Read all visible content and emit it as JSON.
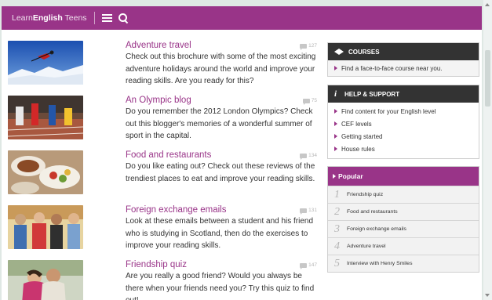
{
  "header": {
    "logo_light": "Learn",
    "logo_bold": "English",
    "logo_end": " Teens"
  },
  "articles": [
    {
      "title": "Adventure travel",
      "count": "127",
      "text": "Check out this brochure with some of the most exciting adventure holidays around the world and improve your reading skills. Are you ready for this?"
    },
    {
      "title": "An Olympic blog",
      "count": "75",
      "text": "Do you remember the 2012 London Olympics? Check out this blogger's memories of a wonderful summer of sport in the capital."
    },
    {
      "title": "Food and restaurants",
      "count": "134",
      "text": "Do you like eating out? Check out these reviews of the trendiest places to eat and improve your reading skills."
    },
    {
      "title": "Foreign exchange emails",
      "count": "131",
      "text": "Look at these emails between a student and his friend who is studying in Scotland, then do the exercises to improve your reading skills."
    },
    {
      "title": "Friendship quiz",
      "count": "147",
      "text": "Are you really a good friend? Would you always be there when your friends need you? Try this quiz to find out!"
    }
  ],
  "courses": {
    "heading": "COURSES",
    "items": [
      "Find a face-to-face course near you."
    ]
  },
  "help": {
    "heading": "HELP & SUPPORT",
    "items": [
      "Find content for your English level",
      "CEF levels",
      "Getting started",
      "House rules"
    ]
  },
  "popular": {
    "heading": "Popular",
    "items": [
      {
        "num": "1",
        "label": "Friendship quiz"
      },
      {
        "num": "2",
        "label": "Food and restaurants"
      },
      {
        "num": "3",
        "label": "Foreign exchange emails"
      },
      {
        "num": "4",
        "label": "Adventure travel"
      },
      {
        "num": "5",
        "label": "Interview with Henry Smiles"
      }
    ]
  },
  "colors": {
    "brand": "#993488",
    "dark": "#333333"
  }
}
